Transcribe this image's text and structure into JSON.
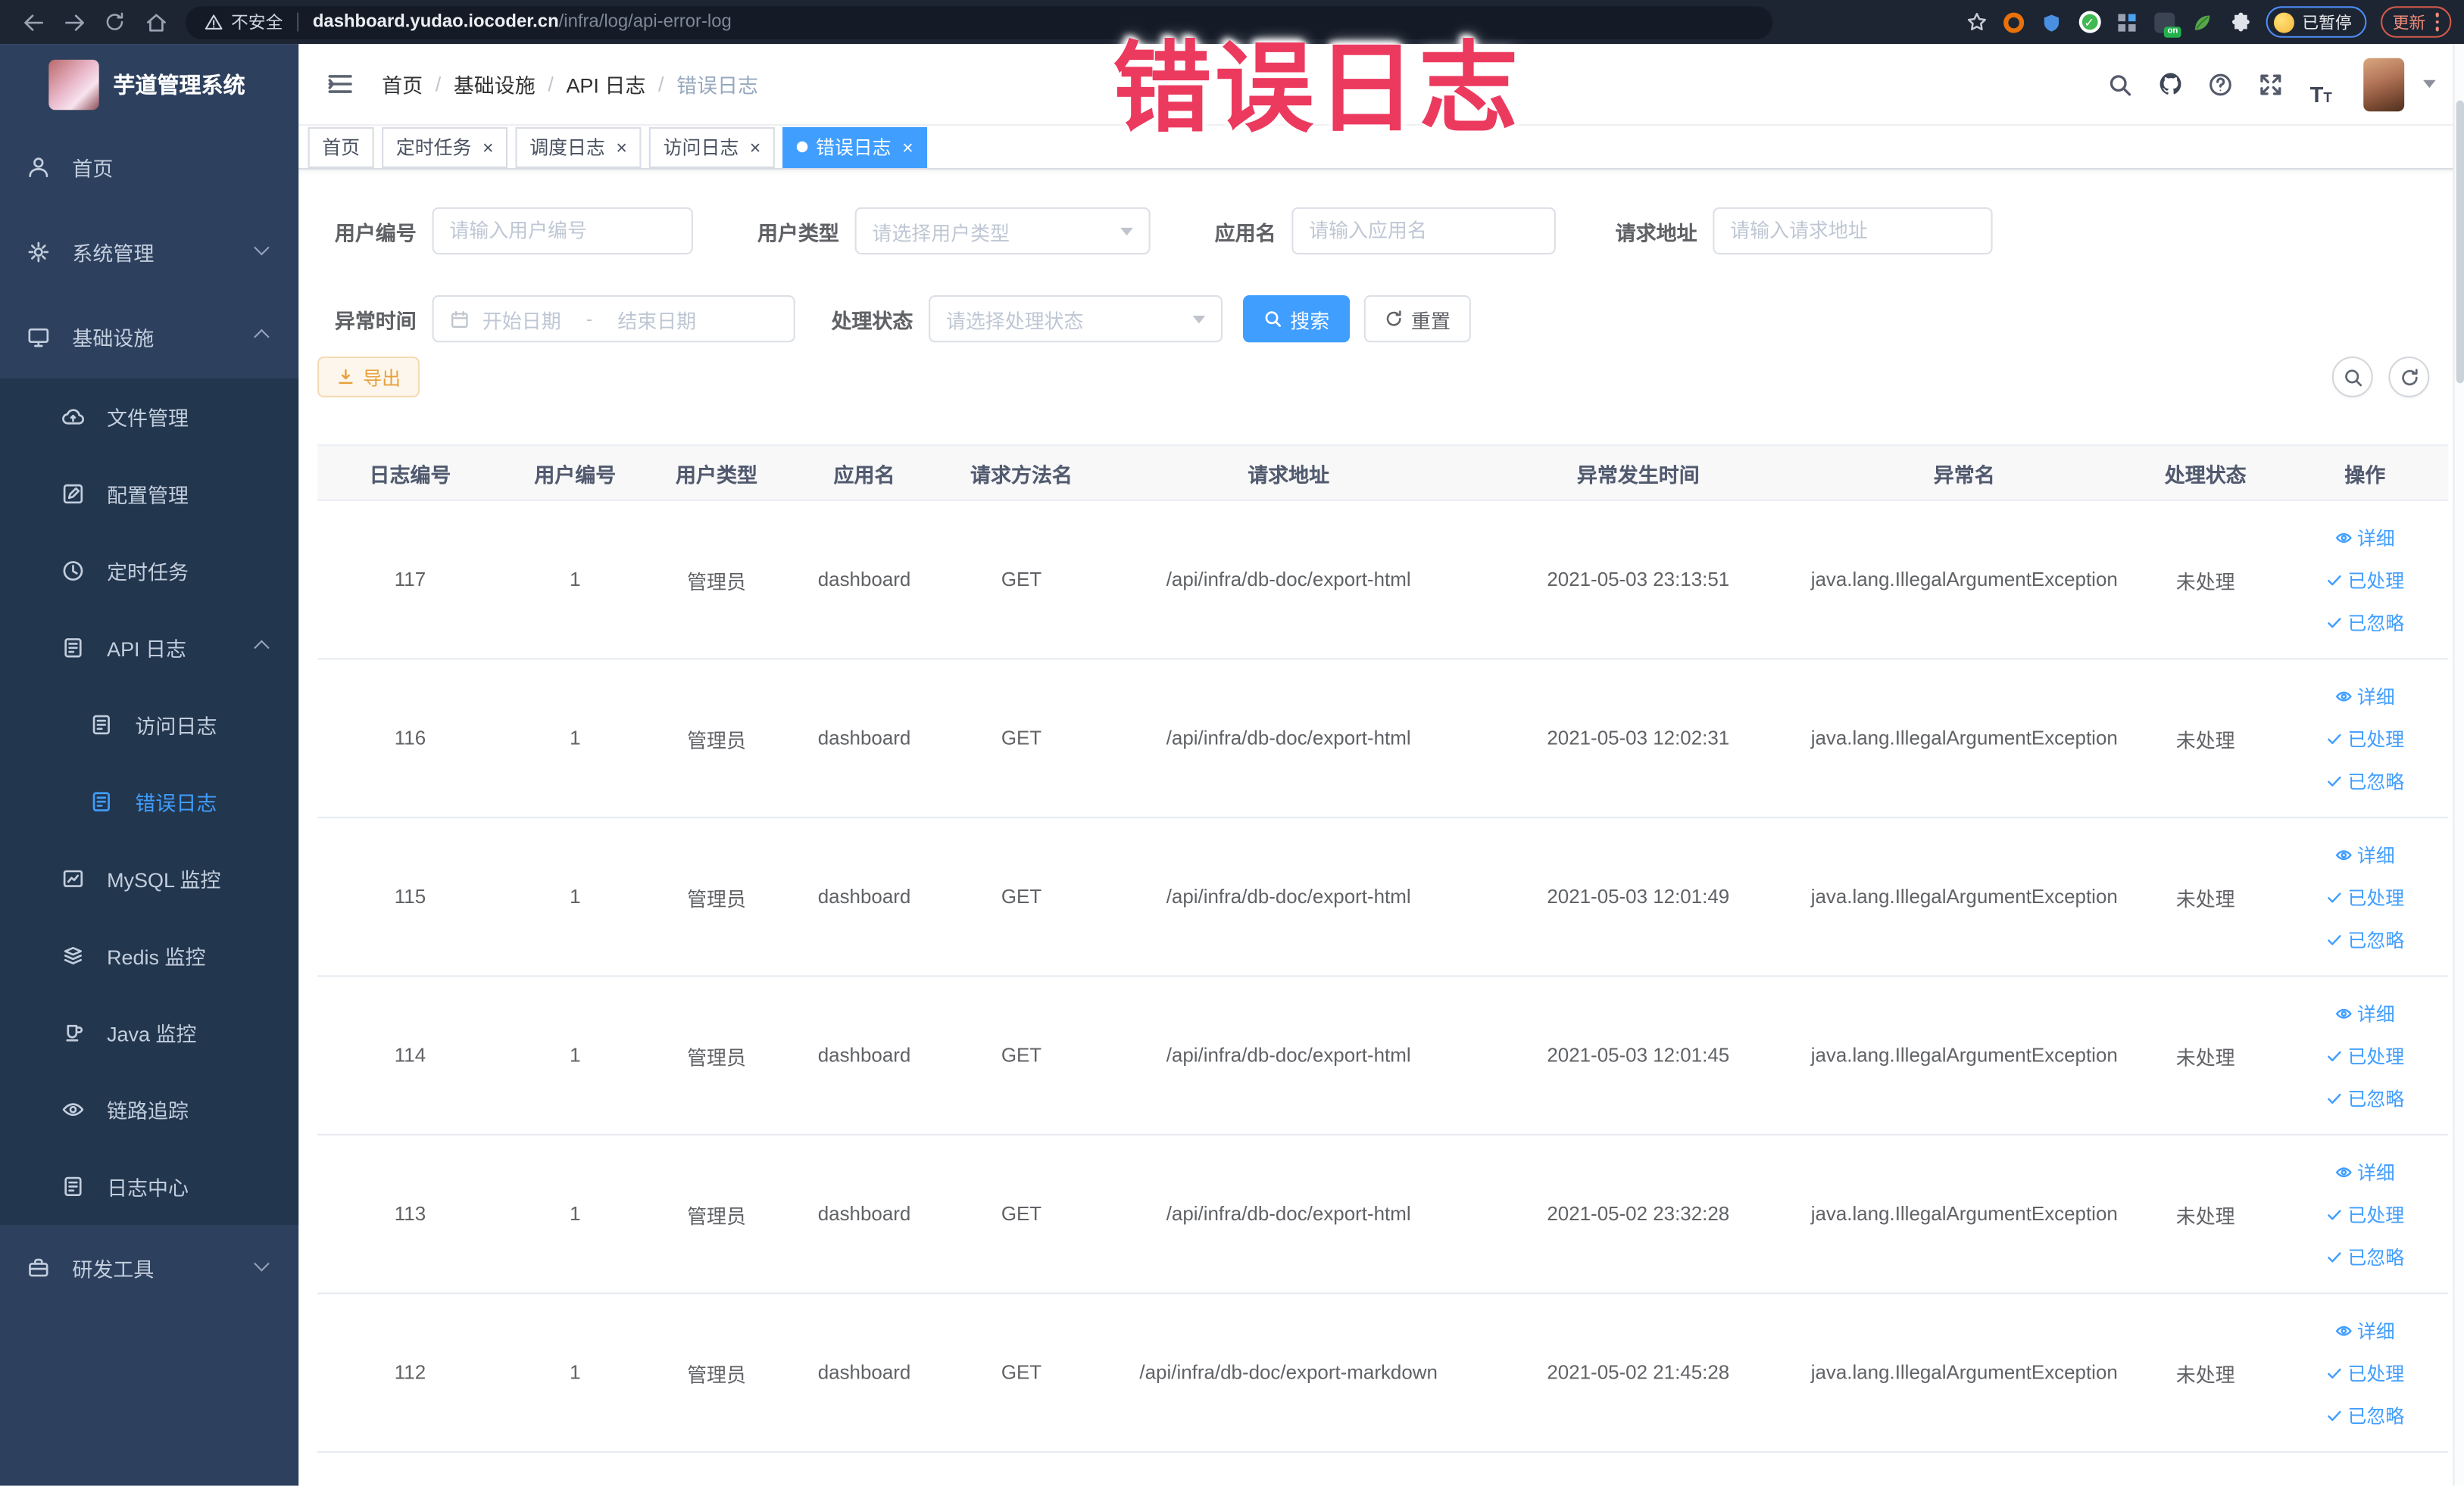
{
  "browser": {
    "security_label": "不安全",
    "url_domain": "dashboard.yudao.iocoder.cn",
    "url_path": "/infra/log/api-error-log",
    "profile_label": "已暂停",
    "update_label": "更新"
  },
  "annotation": {
    "text": "错误日志",
    "color": "#ec3a5f"
  },
  "sidebar": {
    "title": "芋道管理系统",
    "items": [
      {
        "label": "首页",
        "icon": "people",
        "level": 0
      },
      {
        "label": "系统管理",
        "icon": "gear",
        "level": 0,
        "arrow": "down"
      },
      {
        "label": "基础设施",
        "icon": "monitor",
        "level": 0,
        "arrow": "up"
      },
      {
        "label": "文件管理",
        "icon": "cloud",
        "level": 1,
        "sub": true
      },
      {
        "label": "配置管理",
        "icon": "edit",
        "level": 1,
        "sub": true
      },
      {
        "label": "定时任务",
        "icon": "clock",
        "level": 1,
        "sub": true
      },
      {
        "label": "API 日志",
        "icon": "log",
        "level": 1,
        "sub": true,
        "arrow": "up"
      },
      {
        "label": "访问日志",
        "icon": "log",
        "level": 2,
        "sub": true
      },
      {
        "label": "错误日志",
        "icon": "log",
        "level": 2,
        "sub": true,
        "active": true
      },
      {
        "label": "MySQL 监控",
        "icon": "db",
        "level": 1,
        "sub": true
      },
      {
        "label": "Redis 监控",
        "icon": "redis",
        "level": 1,
        "sub": true
      },
      {
        "label": "Java 监控",
        "icon": "java",
        "level": 1,
        "sub": true
      },
      {
        "label": "链路追踪",
        "icon": "eye",
        "level": 1,
        "sub": true
      },
      {
        "label": "日志中心",
        "icon": "log",
        "level": 1,
        "sub": true
      },
      {
        "label": "研发工具",
        "icon": "toolbox",
        "level": 0,
        "arrow": "down"
      }
    ]
  },
  "header": {
    "breadcrumb": [
      "首页",
      "基础设施",
      "API 日志",
      "错误日志"
    ],
    "breadcrumb_separator": "/"
  },
  "tabs": [
    {
      "label": "首页",
      "closable": false,
      "active": false
    },
    {
      "label": "定时任务",
      "closable": true,
      "active": false
    },
    {
      "label": "调度日志",
      "closable": true,
      "active": false
    },
    {
      "label": "访问日志",
      "closable": true,
      "active": false
    },
    {
      "label": "错误日志",
      "closable": true,
      "active": true
    }
  ],
  "filters": {
    "user_id": {
      "label": "用户编号",
      "placeholder": "请输入用户编号"
    },
    "user_type": {
      "label": "用户类型",
      "placeholder": "请选择用户类型"
    },
    "app_name": {
      "label": "应用名",
      "placeholder": "请输入应用名"
    },
    "request_url": {
      "label": "请求地址",
      "placeholder": "请输入请求地址"
    },
    "exception_time": {
      "label": "异常时间",
      "start_placeholder": "开始日期",
      "separator": "-",
      "end_placeholder": "结束日期"
    },
    "process_status": {
      "label": "处理状态",
      "placeholder": "请选择处理状态"
    },
    "search_label": "搜索",
    "reset_label": "重置"
  },
  "toolbar": {
    "export_label": "导出"
  },
  "table": {
    "columns": [
      "日志编号",
      "用户编号",
      "用户类型",
      "应用名",
      "请求方法名",
      "请求地址",
      "异常发生时间",
      "异常名",
      "处理状态",
      "操作"
    ],
    "actions": [
      {
        "key": "detail",
        "label": "详细",
        "icon": "eye"
      },
      {
        "key": "processed",
        "label": "已处理",
        "icon": "check"
      },
      {
        "key": "ignored",
        "label": "已忽略",
        "icon": "check"
      }
    ],
    "rows": [
      {
        "id": "117",
        "user_id": "1",
        "user_type": "管理员",
        "app": "dashboard",
        "method": "GET",
        "url": "/api/infra/db-doc/export-html",
        "time": "2021-05-03 23:13:51",
        "exception": "java.lang.IllegalArgumentException",
        "status": "未处理"
      },
      {
        "id": "116",
        "user_id": "1",
        "user_type": "管理员",
        "app": "dashboard",
        "method": "GET",
        "url": "/api/infra/db-doc/export-html",
        "time": "2021-05-03 12:02:31",
        "exception": "java.lang.IllegalArgumentException",
        "status": "未处理"
      },
      {
        "id": "115",
        "user_id": "1",
        "user_type": "管理员",
        "app": "dashboard",
        "method": "GET",
        "url": "/api/infra/db-doc/export-html",
        "time": "2021-05-03 12:01:49",
        "exception": "java.lang.IllegalArgumentException",
        "status": "未处理"
      },
      {
        "id": "114",
        "user_id": "1",
        "user_type": "管理员",
        "app": "dashboard",
        "method": "GET",
        "url": "/api/infra/db-doc/export-html",
        "time": "2021-05-03 12:01:45",
        "exception": "java.lang.IllegalArgumentException",
        "status": "未处理"
      },
      {
        "id": "113",
        "user_id": "1",
        "user_type": "管理员",
        "app": "dashboard",
        "method": "GET",
        "url": "/api/infra/db-doc/export-html",
        "time": "2021-05-02 23:32:28",
        "exception": "java.lang.IllegalArgumentException",
        "status": "未处理"
      },
      {
        "id": "112",
        "user_id": "1",
        "user_type": "管理员",
        "app": "dashboard",
        "method": "GET",
        "url": "/api/infra/db-doc/export-markdown",
        "time": "2021-05-02 21:45:28",
        "exception": "java.lang.IllegalArgumentException",
        "status": "未处理"
      }
    ]
  },
  "colors": {
    "accent": "#409eff",
    "sidebar_bg": "#2d405e",
    "submenu_bg": "#22364e",
    "annotation_pink": "#ec3a5f",
    "warn_button_text": "#e6a23c",
    "update_red": "#d4594a",
    "profile_blue": "#4e8df6"
  }
}
